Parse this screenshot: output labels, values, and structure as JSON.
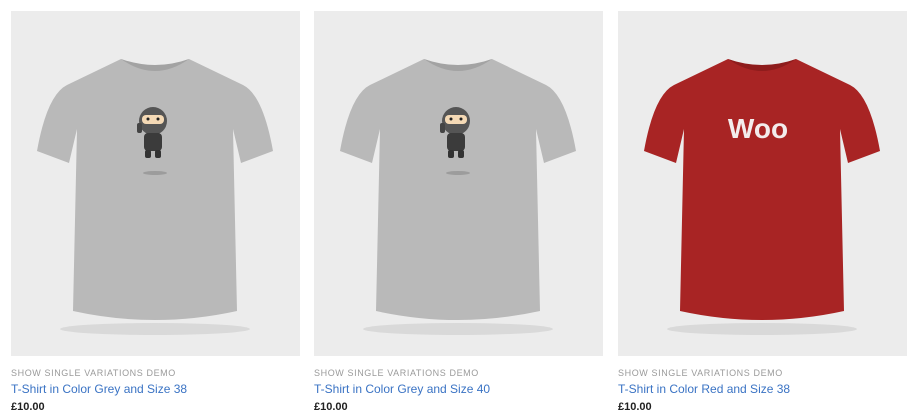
{
  "products": [
    {
      "category": "SHOW SINGLE VARIATIONS DEMO",
      "title": "T-Shirt in Color Grey and Size 38",
      "price": "£10.00",
      "shirt_color": "#b9b9b9",
      "print": "ninja"
    },
    {
      "category": "SHOW SINGLE VARIATIONS DEMO",
      "title": "T-Shirt in Color Grey and Size 40",
      "price": "£10.00",
      "shirt_color": "#b9b9b9",
      "print": "ninja"
    },
    {
      "category": "SHOW SINGLE VARIATIONS DEMO",
      "title": "T-Shirt in Color Red and Size 38",
      "price": "£10.00",
      "shirt_color": "#a82424",
      "print": "woo",
      "print_text": "Woo"
    }
  ],
  "colors": {
    "link": "#3a73c4",
    "category": "#9a9a9a",
    "price": "#222222",
    "thumb_bg": "#ececec"
  }
}
